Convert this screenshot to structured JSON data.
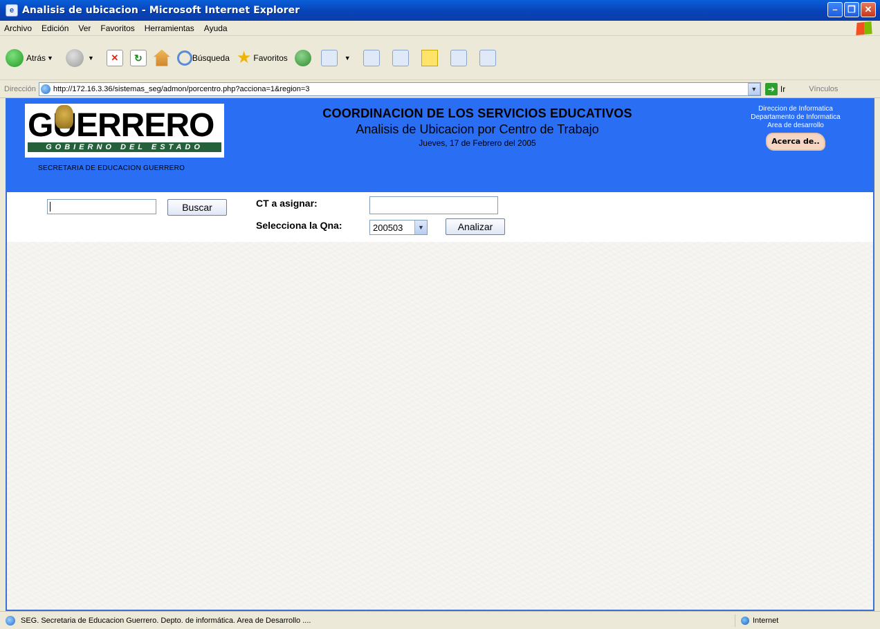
{
  "window": {
    "title": "Analisis de ubicacion - Microsoft Internet Explorer"
  },
  "menu": {
    "items": [
      "Archivo",
      "Edición",
      "Ver",
      "Favoritos",
      "Herramientas",
      "Ayuda"
    ]
  },
  "toolbar": {
    "back_label": "Atrás",
    "search_label": "Búsqueda",
    "favorites_label": "Favoritos"
  },
  "address": {
    "label": "Dirección",
    "url": "http://172.16.3.36/sistemas_seg/admon/porcentro.php?acciona=1&region=3",
    "go_label": "Ir",
    "links_label": "Vínculos"
  },
  "header": {
    "logo_word": "GUERRERO",
    "logo_strip": "GOBIERNO DEL ESTADO",
    "logo_subtitle": "SECRETARIA DE EDUCACION GUERRERO",
    "title": "COORDINACION DE LOS SERVICIOS EDUCATIVOS",
    "subtitle": "Analisis de Ubicacion por Centro de Trabajo",
    "date": "Jueves, 17 de Febrero del 2005",
    "right_line1": "Direccion de Informatica",
    "right_line2": "Departamento de Informatica",
    "right_line3": "Area de desarrollo",
    "about_label": "Acerca de.."
  },
  "form": {
    "search_button": "Buscar",
    "ct_label": "CT a asignar:",
    "qna_label": "Selecciona la Qna:",
    "qna_value": "200503",
    "analyze_button": "Analizar"
  },
  "status": {
    "text": "SEG. Secretaria de Educacion Guerrero. Depto. de informática. Area de Desarrollo ....",
    "zone": "Internet"
  }
}
